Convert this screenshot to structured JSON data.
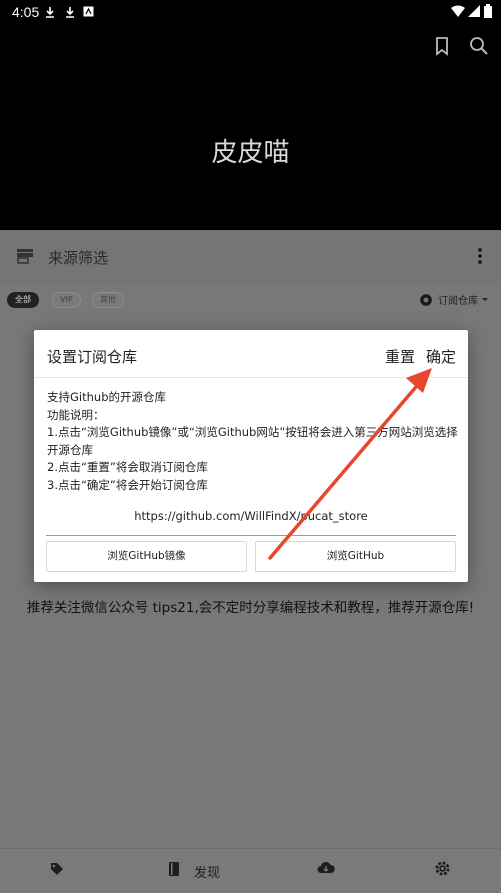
{
  "status_bar": {
    "time": "4:05"
  },
  "header": {
    "title": "皮皮喵"
  },
  "toolbar": {
    "title": "来源筛选"
  },
  "filters": {
    "chips": [
      "全部",
      "VIP",
      "其他"
    ],
    "subscribe_label": "订阅仓库"
  },
  "dialog": {
    "title": "设置订阅仓库",
    "reset_label": "重置",
    "confirm_label": "确定",
    "body_lines": [
      "支持Github的开源仓库",
      "功能说明：",
      "1.点击“浏览Github镜像”或“浏览Github网站”按钮将会进入第三方网站浏览选择",
      "开源仓库",
      "2.点击“重置”将会取消订阅仓库",
      "3.点击“确定”将会开始订阅仓库"
    ],
    "url": "https://github.com/WillFindX/pucat_store",
    "mirror_button": "浏览GitHub镜像",
    "github_button": "浏览GitHub"
  },
  "promo_text": "推荐关注微信公众号 tips21,会不定时分享编程技术和教程，推荐开源仓库!",
  "bottom_nav": {
    "discover_label": "发现"
  },
  "colors": {
    "annotation_arrow": "#e8462e",
    "header_bg": "#000000",
    "scrim": "#787878"
  }
}
